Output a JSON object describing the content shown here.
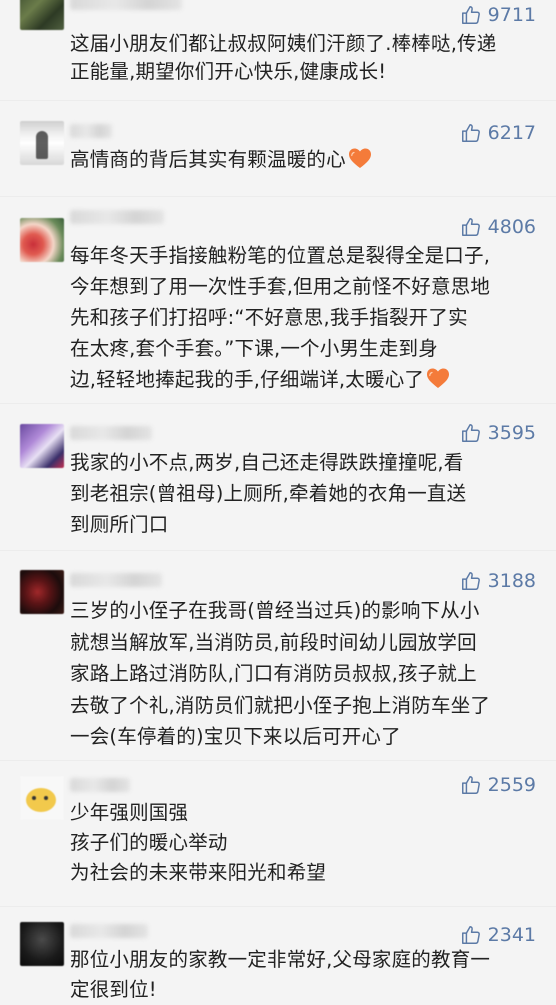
{
  "comments": [
    {
      "likes": "9711",
      "lines": [
        "这届小朋友们都让叔叔阿姨们汗颜了.棒棒哒,传递",
        "正能量,期望你们开心快乐,健康成长!"
      ],
      "heart": false
    },
    {
      "likes": "6217",
      "lines": [
        "高情商的背后其实有颗温暖的心"
      ],
      "heart": true
    },
    {
      "likes": "4806",
      "lines": [
        "每年冬天手指接触粉笔的位置总是裂得全是口子,",
        "今年想到了用一次性手套,但用之前怪不好意思地",
        "先和孩子们打招呼:“不好意思,我手指裂开了实",
        "在太疼,套个手套。”下课,一个小男生走到身",
        "边,轻轻地捧起我的手,仔细端详,太暖心了"
      ],
      "heart": true
    },
    {
      "likes": "3595",
      "lines": [
        "我家的小不点,两岁,自己还走得跌跌撞撞呢,看",
        "到老祖宗(曾祖母)上厕所,牵着她的衣角一直送",
        "到厕所门口"
      ],
      "heart": false
    },
    {
      "likes": "3188",
      "lines": [
        "三岁的小侄子在我哥(曾经当过兵)的影响下从小",
        "就想当解放军,当消防员,前段时间幼儿园放学回",
        "家路上路过消防队,门口有消防员叔叔,孩子就上",
        "去敬了个礼,消防员们就把小侄子抱上消防车坐了",
        "一会(车停着的)宝贝下来以后可开心了"
      ],
      "heart": false
    },
    {
      "likes": "2559",
      "lines": [
        "少年强则国强",
        "孩子们的暖心举动",
        "为社会的未来带来阳光和希望"
      ],
      "heart": false
    },
    {
      "likes": "2341",
      "lines": [
        "那位小朋友的家教一定非常好,父母家庭的教育一",
        "定很到位!"
      ],
      "heart": false
    }
  ],
  "colors": {
    "like_blue": "#5c7aa6",
    "heart_orange": "#f47b3a",
    "text": "#222222"
  },
  "icons": {
    "like": "thumbs-up-icon",
    "heart": "heart-icon"
  }
}
